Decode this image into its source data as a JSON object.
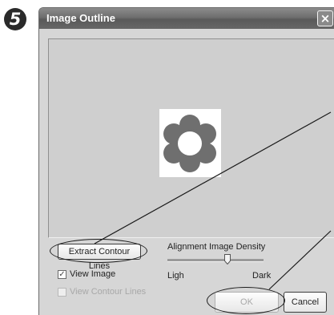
{
  "step_number": "5",
  "dialog": {
    "title": "Image Outline",
    "close_glyph": "×"
  },
  "preview": {
    "image_icon": "flower-shape-icon",
    "shape_color": "#6f6f6f"
  },
  "controls": {
    "extract_button": "Extract Contour Lines",
    "density_label": "Alignment Image Density",
    "slider_min_label": "Ligh",
    "slider_max_label": "Dark",
    "view_image_label": "View Image",
    "view_image_checked": true,
    "view_contour_label": "View Contour Lines",
    "view_contour_checked": false
  },
  "buttons": {
    "ok": "OK",
    "cancel": "Cancel"
  }
}
